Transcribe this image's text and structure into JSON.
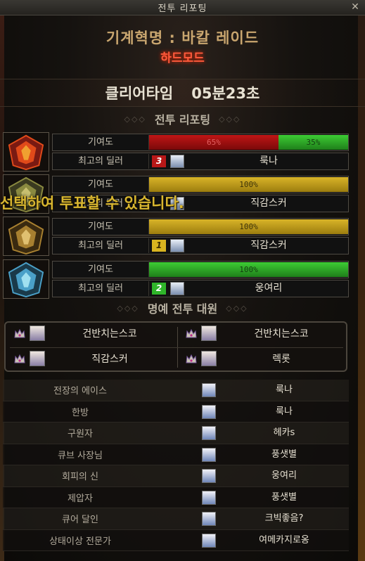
{
  "window": {
    "title": "전투 리포팅"
  },
  "header": {
    "raid_title": "기계혁명 : 바칼 레이드",
    "difficulty": "하드모드",
    "clear_time_label": "클리어타임",
    "clear_time_value": "05분23초"
  },
  "sections": {
    "battle_report": "전투 리포팅",
    "honor": "명예 전투 대원"
  },
  "overlay_notice": "선택하여 투표할 수 있습니다.",
  "bosses": [
    {
      "contribution_label": "기여도",
      "best_dealer_label": "최고의 딜러",
      "segments": [
        {
          "label": "65%",
          "share": 0.65,
          "color": "red"
        },
        {
          "label": "35%",
          "share": 0.35,
          "color": "green"
        }
      ],
      "rank": "3",
      "rank_color": "red",
      "dealer_name": "룩나"
    },
    {
      "contribution_label": "기여도",
      "best_dealer_label": "최고의 딜러",
      "segments": [
        {
          "label": "100%",
          "share": 1.0,
          "color": "yellow"
        }
      ],
      "rank": "",
      "rank_color": "none",
      "dealer_name": "직감스커"
    },
    {
      "contribution_label": "기여도",
      "best_dealer_label": "최고의 딜러",
      "segments": [
        {
          "label": "100%",
          "share": 1.0,
          "color": "yellow"
        }
      ],
      "rank": "1",
      "rank_color": "yellow",
      "dealer_name": "직감스커"
    },
    {
      "contribution_label": "기여도",
      "best_dealer_label": "최고의 딜러",
      "segments": [
        {
          "label": "100%",
          "share": 1.0,
          "color": "green"
        }
      ],
      "rank": "2",
      "rank_color": "green",
      "dealer_name": "웅여리"
    }
  ],
  "honor_members": [
    {
      "name": "건반치는스코"
    },
    {
      "name": "건반치는스코"
    },
    {
      "name": "직감스커"
    },
    {
      "name": "렉롯"
    }
  ],
  "awards": [
    {
      "title": "전장의 에이스",
      "name": "룩나"
    },
    {
      "title": "한방",
      "name": "룩나"
    },
    {
      "title": "구원자",
      "name": "헤카s"
    },
    {
      "title": "큐브 사장님",
      "name": "풍샛별"
    },
    {
      "title": "회피의 신",
      "name": "웅여리"
    },
    {
      "title": "제압자",
      "name": "풍샛별"
    },
    {
      "title": "큐어 달인",
      "name": "크빅좋음?"
    },
    {
      "title": "상태이상 전문가",
      "name": "여메카지로옹"
    }
  ],
  "colors": {
    "red": "#b81818",
    "green": "#2fb52a",
    "yellow": "#d9b420",
    "accent": "#ff5a3c"
  }
}
